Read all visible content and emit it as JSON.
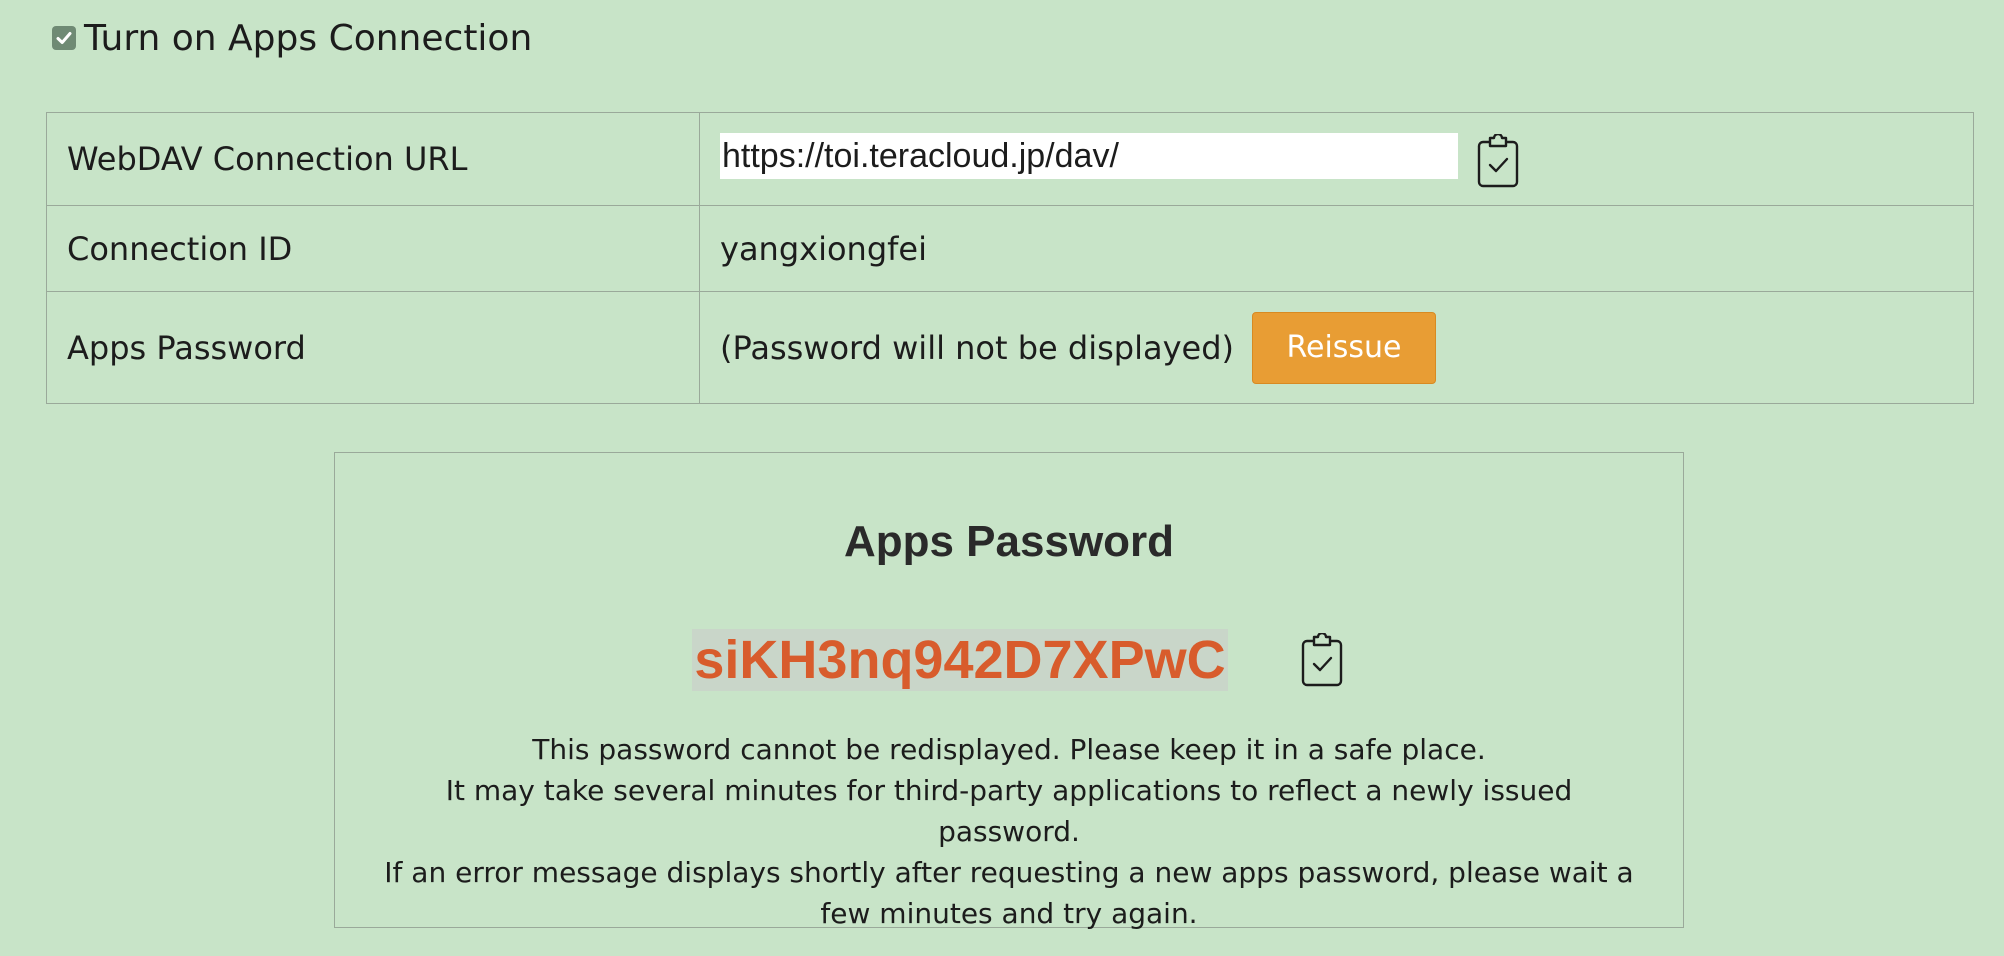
{
  "toggle": {
    "label": "Turn on Apps Connection",
    "checked": true
  },
  "settings": {
    "url_label": "WebDAV Connection URL",
    "url_value": "https://toi.teracloud.jp/dav/",
    "id_label": "Connection ID",
    "id_value": "yangxiongfei",
    "password_label": "Apps Password",
    "password_note": "(Password will not be displayed)",
    "reissue_label": "Reissue"
  },
  "password_panel": {
    "title": "Apps Password",
    "password": "siKH3nq942D7XPwC",
    "notes": [
      "This password cannot be redisplayed. Please keep it in a safe place.",
      "It may take several minutes for third-party applications to reflect a newly issued password.",
      "If an error message displays shortly after requesting a new apps password, please wait a few minutes and try again."
    ]
  },
  "colors": {
    "background": "#c8e4c8",
    "button": "#e89d34",
    "password_text": "#d85c2c",
    "password_highlight": "#c9d6c9"
  },
  "icons": {
    "copy_url": "clipboard-check-icon",
    "copy_password": "clipboard-check-icon",
    "checkbox": "checkmark-icon"
  }
}
